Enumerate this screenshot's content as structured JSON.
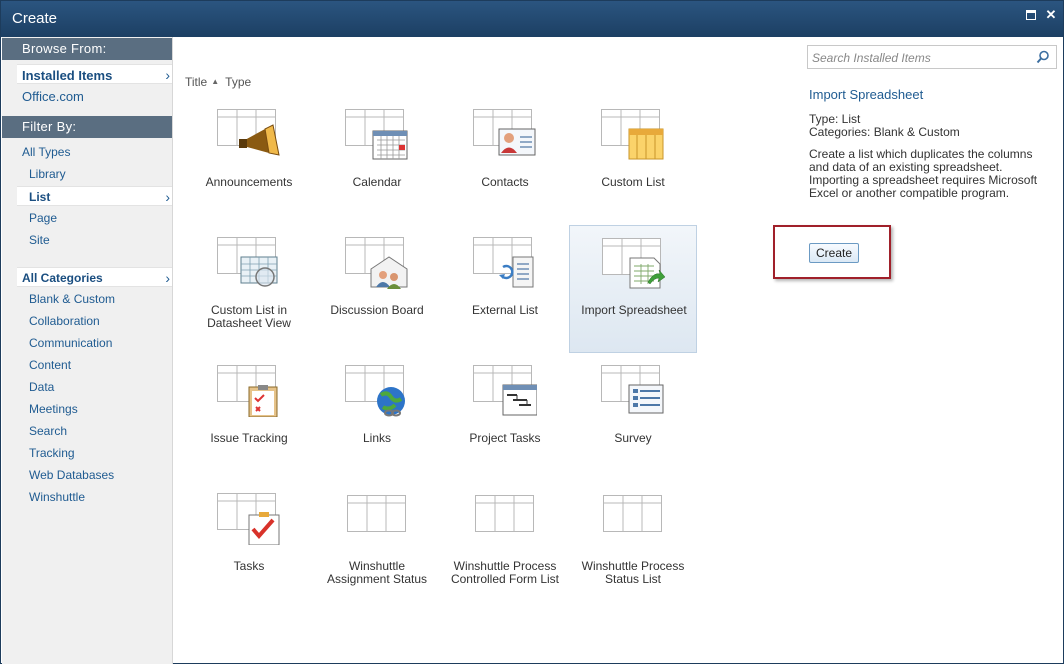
{
  "window": {
    "title": "Create"
  },
  "sidebar": {
    "browse_header": "Browse From:",
    "browse_items": [
      {
        "label": "Installed Items",
        "selected": true
      },
      {
        "label": "Office.com"
      }
    ],
    "filter_header": "Filter By:",
    "types": [
      {
        "label": "All Types"
      },
      {
        "label": "Library"
      },
      {
        "label": "List",
        "selected": true
      },
      {
        "label": "Page"
      },
      {
        "label": "Site"
      }
    ],
    "categories_header": "All Categories",
    "categories": [
      "Blank & Custom",
      "Collaboration",
      "Communication",
      "Content",
      "Data",
      "Meetings",
      "Search",
      "Tracking",
      "Web Databases",
      "Winshuttle"
    ]
  },
  "sort": {
    "title_label": "Title",
    "type_label": "Type"
  },
  "tiles": [
    {
      "label": "Announcements",
      "icon": "announcements-icon"
    },
    {
      "label": "Calendar",
      "icon": "calendar-icon"
    },
    {
      "label": "Contacts",
      "icon": "contacts-icon"
    },
    {
      "label": "Custom List",
      "icon": "custom-list-icon"
    },
    {
      "label": "Custom List in Datasheet View",
      "icon": "datasheet-icon"
    },
    {
      "label": "Discussion Board",
      "icon": "discussion-board-icon"
    },
    {
      "label": "External List",
      "icon": "external-list-icon"
    },
    {
      "label": "Import Spreadsheet",
      "icon": "import-spreadsheet-icon",
      "selected": true
    },
    {
      "label": "Issue Tracking",
      "icon": "issue-tracking-icon"
    },
    {
      "label": "Links",
      "icon": "links-icon"
    },
    {
      "label": "Project Tasks",
      "icon": "project-tasks-icon"
    },
    {
      "label": "Survey",
      "icon": "survey-icon"
    },
    {
      "label": "Tasks",
      "icon": "tasks-icon"
    },
    {
      "label": "Winshuttle Assignment Status",
      "icon": "list-icon"
    },
    {
      "label": "Winshuttle Process Controlled Form List",
      "icon": "list-icon"
    },
    {
      "label": "Winshuttle Process Status List",
      "icon": "list-icon"
    }
  ],
  "search": {
    "placeholder": "Search Installed Items"
  },
  "details": {
    "title": "Import Spreadsheet",
    "type_line": "Type: List",
    "categories_line": "Categories: Blank & Custom",
    "description": "Create a list which duplicates the columns and data of an existing spreadsheet.  Importing a spreadsheet requires Microsoft Excel or another compatible program.",
    "create_label": "Create"
  },
  "colors": {
    "titlebar": "#1c3f63",
    "link": "#1f5b91",
    "section_header": "#5a6e81",
    "highlight": "#a0202a"
  }
}
